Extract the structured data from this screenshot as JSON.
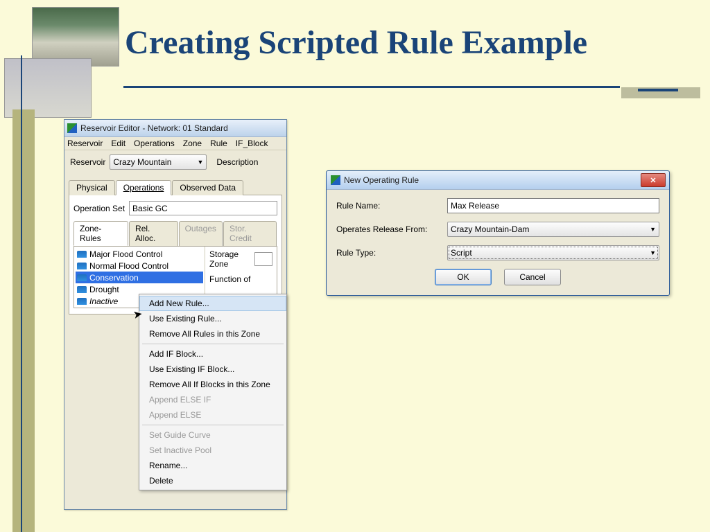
{
  "slide": {
    "title": "Creating Scripted Rule Example"
  },
  "editor": {
    "title": "Reservoir Editor - Network: 01 Standard",
    "menu": [
      "Reservoir",
      "Edit",
      "Operations",
      "Zone",
      "Rule",
      "IF_Block"
    ],
    "reservoir_label": "Reservoir",
    "reservoir_value": "Crazy Mountain",
    "description_label": "Description",
    "tabs": [
      "Physical",
      "Operations",
      "Observed Data"
    ],
    "active_tab": "Operations",
    "opset_label": "Operation Set",
    "opset_value": "Basic GC",
    "subtabs": [
      {
        "label": "Zone-Rules",
        "state": "active"
      },
      {
        "label": "Rel. Alloc.",
        "state": ""
      },
      {
        "label": "Outages",
        "state": "disabled"
      },
      {
        "label": "Stor. Credit",
        "state": "disabled"
      }
    ],
    "zones": [
      {
        "label": "Major Flood Control",
        "selected": false,
        "italic": false
      },
      {
        "label": "Normal Flood Control",
        "selected": false,
        "italic": false
      },
      {
        "label": "Conservation",
        "selected": true,
        "italic": false
      },
      {
        "label": "Drought",
        "selected": false,
        "italic": false
      },
      {
        "label": "Inactive",
        "selected": false,
        "italic": true
      }
    ],
    "zone_right": {
      "storage_label": "Storage Zone",
      "func_label": "Function of"
    }
  },
  "ctx": {
    "items": [
      {
        "label": "Add New Rule...",
        "state": "hover"
      },
      {
        "label": "Use Existing Rule...",
        "state": ""
      },
      {
        "label": "Remove All Rules in this Zone",
        "state": ""
      },
      {
        "label": "sep",
        "state": "sep"
      },
      {
        "label": "Add IF Block...",
        "state": ""
      },
      {
        "label": "Use Existing IF Block...",
        "state": ""
      },
      {
        "label": "Remove All If Blocks in this Zone",
        "state": ""
      },
      {
        "label": "Append ELSE IF",
        "state": "disabled"
      },
      {
        "label": "Append ELSE",
        "state": "disabled"
      },
      {
        "label": "sep",
        "state": "sep"
      },
      {
        "label": "Set Guide Curve",
        "state": "disabled"
      },
      {
        "label": "Set Inactive Pool",
        "state": "disabled"
      },
      {
        "label": "Rename...",
        "state": ""
      },
      {
        "label": "Delete",
        "state": ""
      }
    ]
  },
  "dialog": {
    "title": "New Operating Rule",
    "rule_name_label": "Rule Name:",
    "rule_name_value": "Max Release",
    "operates_label": "Operates Release From:",
    "operates_value": "Crazy Mountain-Dam",
    "type_label": "Rule Type:",
    "type_value": "Script",
    "ok": "OK",
    "cancel": "Cancel"
  }
}
